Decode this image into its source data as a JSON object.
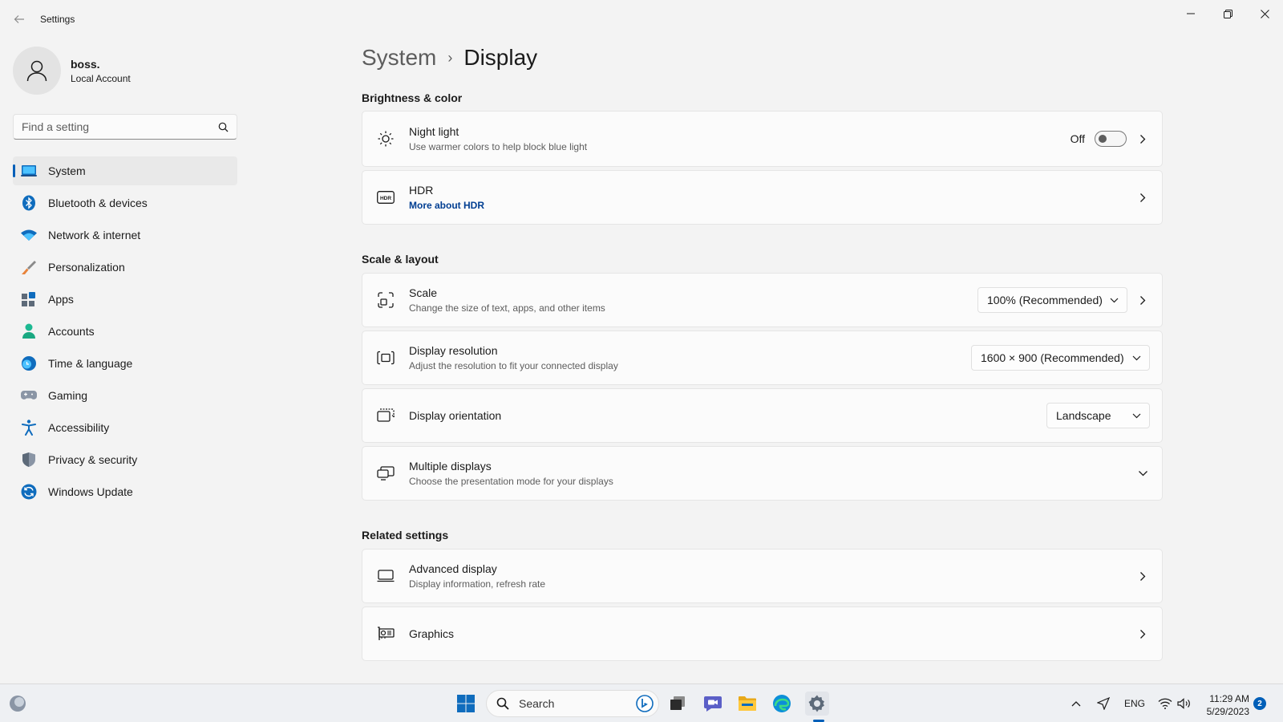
{
  "window": {
    "app_title": "Settings"
  },
  "profile": {
    "name": "boss.",
    "account_type": "Local Account"
  },
  "search": {
    "placeholder": "Find a setting"
  },
  "sidebar": {
    "items": [
      {
        "label": "System",
        "icon": "laptop-icon",
        "active": true
      },
      {
        "label": "Bluetooth & devices",
        "icon": "bluetooth-icon"
      },
      {
        "label": "Network & internet",
        "icon": "wifi-icon"
      },
      {
        "label": "Personalization",
        "icon": "brush-icon"
      },
      {
        "label": "Apps",
        "icon": "apps-icon"
      },
      {
        "label": "Accounts",
        "icon": "person-icon"
      },
      {
        "label": "Time & language",
        "icon": "globe-clock-icon"
      },
      {
        "label": "Gaming",
        "icon": "gamepad-icon"
      },
      {
        "label": "Accessibility",
        "icon": "accessibility-icon"
      },
      {
        "label": "Privacy & security",
        "icon": "shield-icon"
      },
      {
        "label": "Windows Update",
        "icon": "update-icon"
      }
    ]
  },
  "breadcrumb": {
    "parent": "System",
    "separator": "›",
    "current": "Display"
  },
  "sections": {
    "brightness": "Brightness & color",
    "scale_layout": "Scale & layout",
    "related": "Related settings"
  },
  "cards": {
    "night_light": {
      "title": "Night light",
      "subtitle": "Use warmer colors to help block blue light",
      "toggle_label": "Off",
      "toggle_on": false
    },
    "hdr": {
      "title": "HDR",
      "link": "More about HDR"
    },
    "scale": {
      "title": "Scale",
      "subtitle": "Change the size of text, apps, and other items",
      "value": "100% (Recommended)"
    },
    "resolution": {
      "title": "Display resolution",
      "subtitle": "Adjust the resolution to fit your connected display",
      "value": "1600 × 900 (Recommended)"
    },
    "orientation": {
      "title": "Display orientation",
      "value": "Landscape"
    },
    "multiple": {
      "title": "Multiple displays",
      "subtitle": "Choose the presentation mode for your displays"
    },
    "advanced": {
      "title": "Advanced display",
      "subtitle": "Display information, refresh rate"
    },
    "graphics": {
      "title": "Graphics"
    }
  },
  "taskbar": {
    "search_label": "Search",
    "language": "ENG",
    "time": "11:29 AM",
    "date": "5/29/2023",
    "notification_count": "2"
  },
  "colors": {
    "accent": "#005fb8",
    "background": "#f3f3f3",
    "card": "#fbfbfb"
  }
}
